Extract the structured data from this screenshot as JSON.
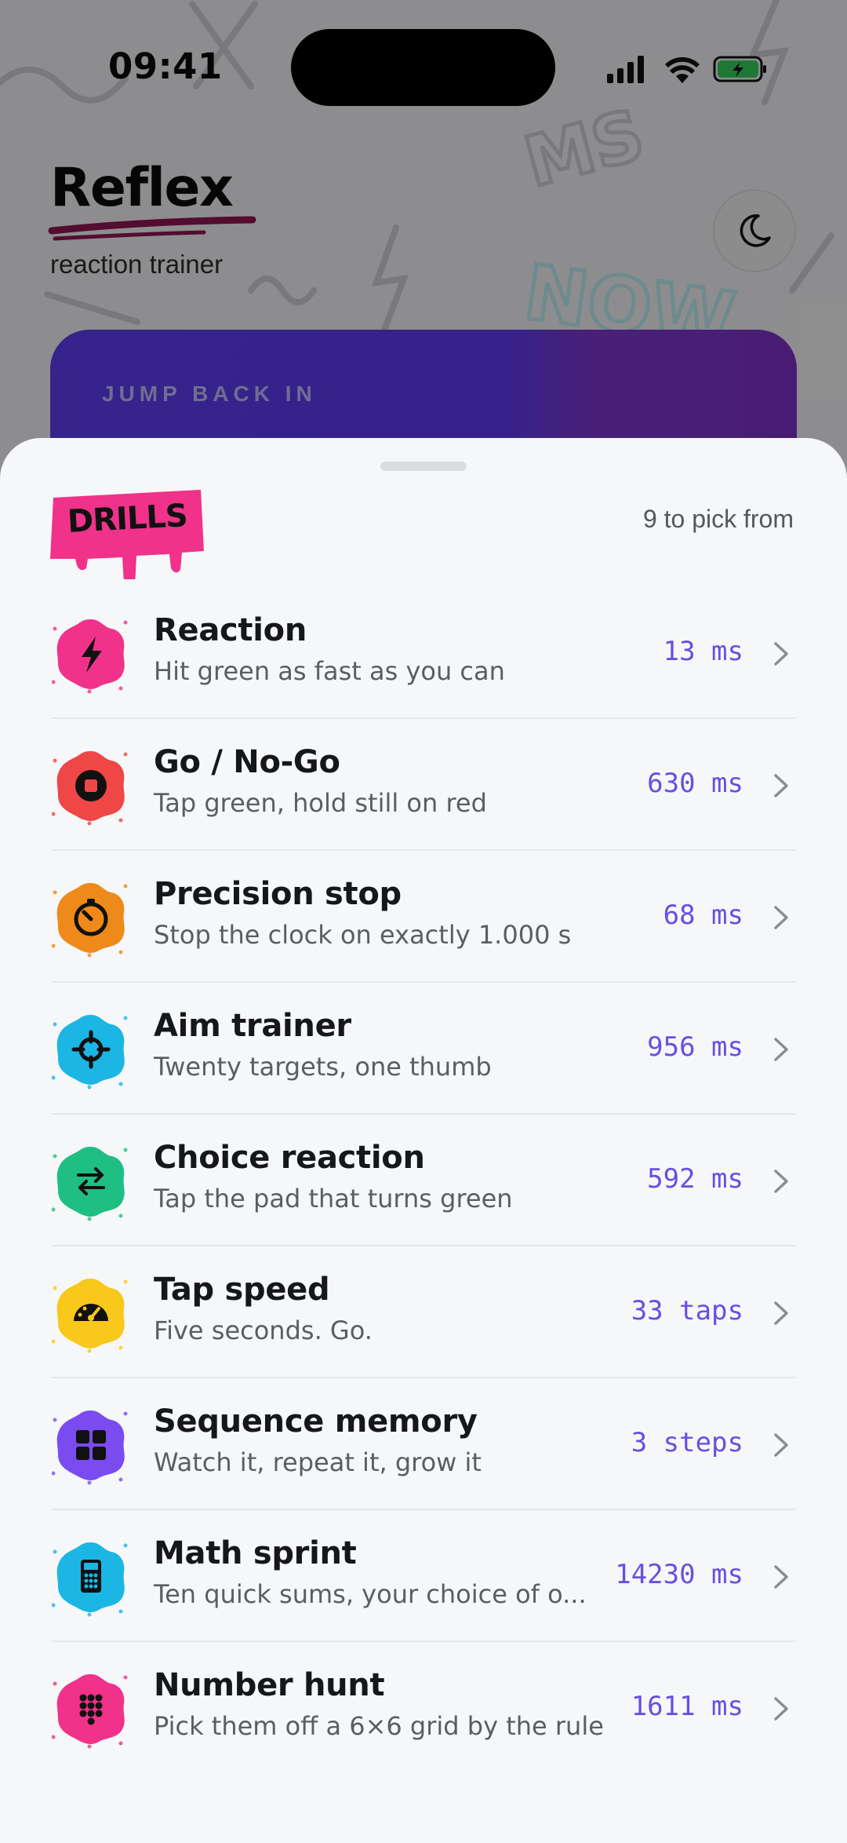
{
  "status_bar": {
    "time": "09:41"
  },
  "header": {
    "title": "Reflex",
    "subtitle": "reaction trainer",
    "theme_toggle_icon": "moon-icon"
  },
  "jump_back": {
    "label": "JUMP BACK IN"
  },
  "sheet": {
    "badge": "DRILLS",
    "count_text": "9 to pick from",
    "drills": [
      {
        "name": "Reaction",
        "desc": "Hit green as fast as you can",
        "score": "13 ms",
        "icon": "lightning-icon",
        "color": "#f0328a"
      },
      {
        "name": "Go / No-Go",
        "desc": "Tap green, hold still on red",
        "score": "630 ms",
        "icon": "stop-icon",
        "color": "#ef4646"
      },
      {
        "name": "Precision stop",
        "desc": "Stop the clock on exactly 1.000 s",
        "score": "68 ms",
        "icon": "timer-icon",
        "color": "#ee8a1a"
      },
      {
        "name": "Aim trainer",
        "desc": "Twenty targets, one thumb",
        "score": "956 ms",
        "icon": "crosshair-icon",
        "color": "#1bb6e4"
      },
      {
        "name": "Choice reaction",
        "desc": "Tap the pad that turns green",
        "score": "592 ms",
        "icon": "swap-arrows-icon",
        "color": "#1fbf84"
      },
      {
        "name": "Tap speed",
        "desc": "Five seconds. Go.",
        "score": "33 taps",
        "icon": "speedometer-icon",
        "color": "#f8c81a"
      },
      {
        "name": "Sequence memory",
        "desc": "Watch it, repeat it, grow it",
        "score": "3 steps",
        "icon": "grid-icon",
        "color": "#7a4cf0"
      },
      {
        "name": "Math sprint",
        "desc": "Ten quick sums, your choice of o...",
        "score": "14230 ms",
        "icon": "calculator-icon",
        "color": "#1bb6e4"
      },
      {
        "name": "Number hunt",
        "desc": "Pick them off a 6×6 grid by the rule",
        "score": "1611 ms",
        "icon": "dial-pad-icon",
        "color": "#f0328a"
      }
    ]
  }
}
